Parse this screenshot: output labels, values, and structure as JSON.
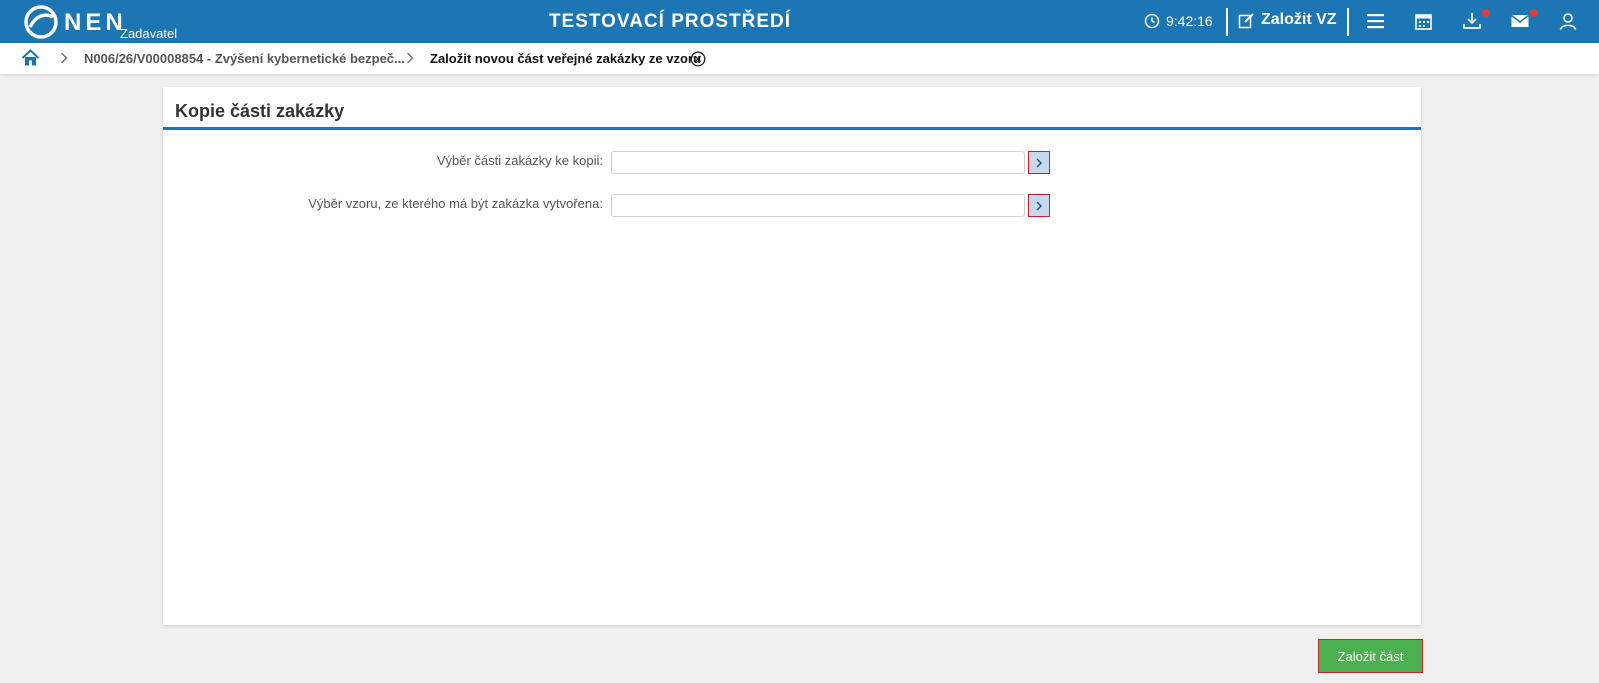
{
  "header": {
    "logo_text": "NEN",
    "logo_sub": "Zadavatel",
    "env_title": "TESTOVACÍ PROSTŘEDÍ",
    "time": "9:42:16",
    "create_label": "Založit VZ",
    "icons": [
      "menu-icon",
      "calendar-icon",
      "download-icon",
      "mail-icon",
      "user-icon"
    ],
    "brand_color": "#1d76b4",
    "badge_color": "#e53935"
  },
  "breadcrumb": {
    "items": [
      {
        "label": "N006/26/V00008854 - Zvýšení kybernetické bezpeč..."
      },
      {
        "label": "Založit novou část veřejné zakázky ze vzoru"
      }
    ]
  },
  "panel": {
    "title": "Kopie části zakázky",
    "fields": [
      {
        "label": "Výběr části zakázky ke kopii:",
        "value": ""
      },
      {
        "label": "Výběr vzoru, ze kterého má být zakázka vytvořena:",
        "value": ""
      }
    ]
  },
  "footer": {
    "submit_label": "Založit část",
    "submit_color": "#4caf50"
  }
}
